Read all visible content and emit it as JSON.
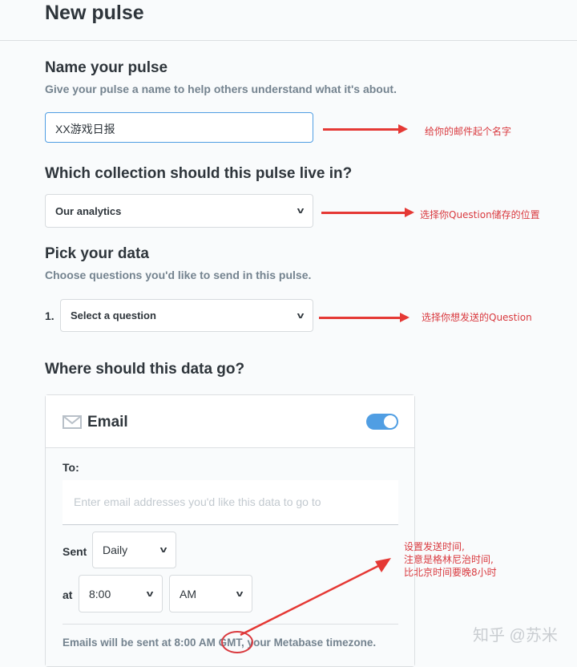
{
  "header": {
    "title": "New pulse"
  },
  "name_section": {
    "title": "Name your pulse",
    "subtitle": "Give your pulse a name to help others understand what it's about.",
    "value": "XX游戏日报"
  },
  "collection_section": {
    "title": "Which collection should this pulse live in?",
    "selected": "Our analytics"
  },
  "data_section": {
    "title": "Pick your data",
    "subtitle": "Choose questions you'd like to send in this pulse.",
    "item_number": "1.",
    "question_placeholder": "Select a question"
  },
  "destination_section": {
    "title": "Where should this data go?"
  },
  "email_card": {
    "title": "Email",
    "enabled": true,
    "to_label": "To:",
    "to_placeholder": "Enter email addresses you'd like this data to go to",
    "sent_label": "Sent",
    "frequency": "Daily",
    "at_label": "at",
    "time": "8:00",
    "ampm": "AM",
    "footer": "Emails will be sent at 8:00 AM GMT, your Metabase timezone."
  },
  "annotations": {
    "name": "给你的邮件起个名字",
    "collection": "选择你Question储存的位置",
    "question": "选择你想发送的Question",
    "time_lines": [
      "设置发送时间,",
      "注意是格林尼治时间,",
      "比北京时间要晚8小时"
    ]
  },
  "watermark": "知乎 @苏米",
  "colors": {
    "accent": "#509ee3",
    "annotation": "#e53935"
  }
}
